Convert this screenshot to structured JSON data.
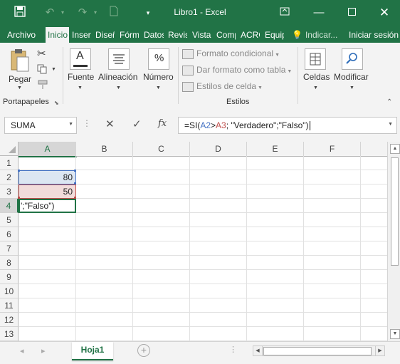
{
  "window": {
    "title": "Libro1 - Excel",
    "icons": [
      "save-icon",
      "undo-icon",
      "redo-icon",
      "new-icon",
      "customize-icon",
      "ribbon-display-icon",
      "minimize-icon",
      "maximize-icon",
      "close-icon"
    ]
  },
  "tabs": [
    {
      "label": "Archivo"
    },
    {
      "label": "Inicio",
      "active": true
    },
    {
      "label": "Insertar"
    },
    {
      "label": "Diseño"
    },
    {
      "label": "Fórmulas"
    },
    {
      "label": "Datos"
    },
    {
      "label": "Revisar"
    },
    {
      "label": "Vista"
    },
    {
      "label": "Complementos"
    },
    {
      "label": "ACROBAT"
    },
    {
      "label": "Equipo"
    },
    {
      "label": "Indicar..."
    },
    {
      "label": "Iniciar sesión"
    }
  ],
  "ribbon": {
    "clipboard": {
      "paste": "Pegar",
      "group": "Portapapeles"
    },
    "font": "Fuente",
    "alignment": "Alineación",
    "number": "Número",
    "styles": {
      "conditional": "Formato condicional",
      "table": "Dar formato como tabla",
      "cell_styles": "Estilos de celda",
      "group": "Estilos"
    },
    "cells": "Celdas",
    "editing": "Modificar"
  },
  "formula_bar": {
    "name_box": "SUMA",
    "fx": "fx",
    "formula": {
      "p1": "=SI(",
      "ref1": "A2",
      "p2": ">",
      "ref2": "A3",
      "p3": "; \"Verdadero\";\"Falso\")"
    }
  },
  "grid": {
    "columns": [
      "A",
      "B",
      "C",
      "D",
      "E",
      "F"
    ],
    "rows": [
      "1",
      "2",
      "3",
      "4",
      "5",
      "6",
      "7",
      "8",
      "9",
      "10",
      "11",
      "12",
      "13"
    ],
    "cells": {
      "A2": "80",
      "A3": "50",
      "A4": "';\"Falso\")"
    }
  },
  "sheet": {
    "tab": "Hoja1"
  },
  "colors": {
    "excel_green": "#217346",
    "ref1": "#4472c4",
    "ref2": "#c0504d"
  }
}
